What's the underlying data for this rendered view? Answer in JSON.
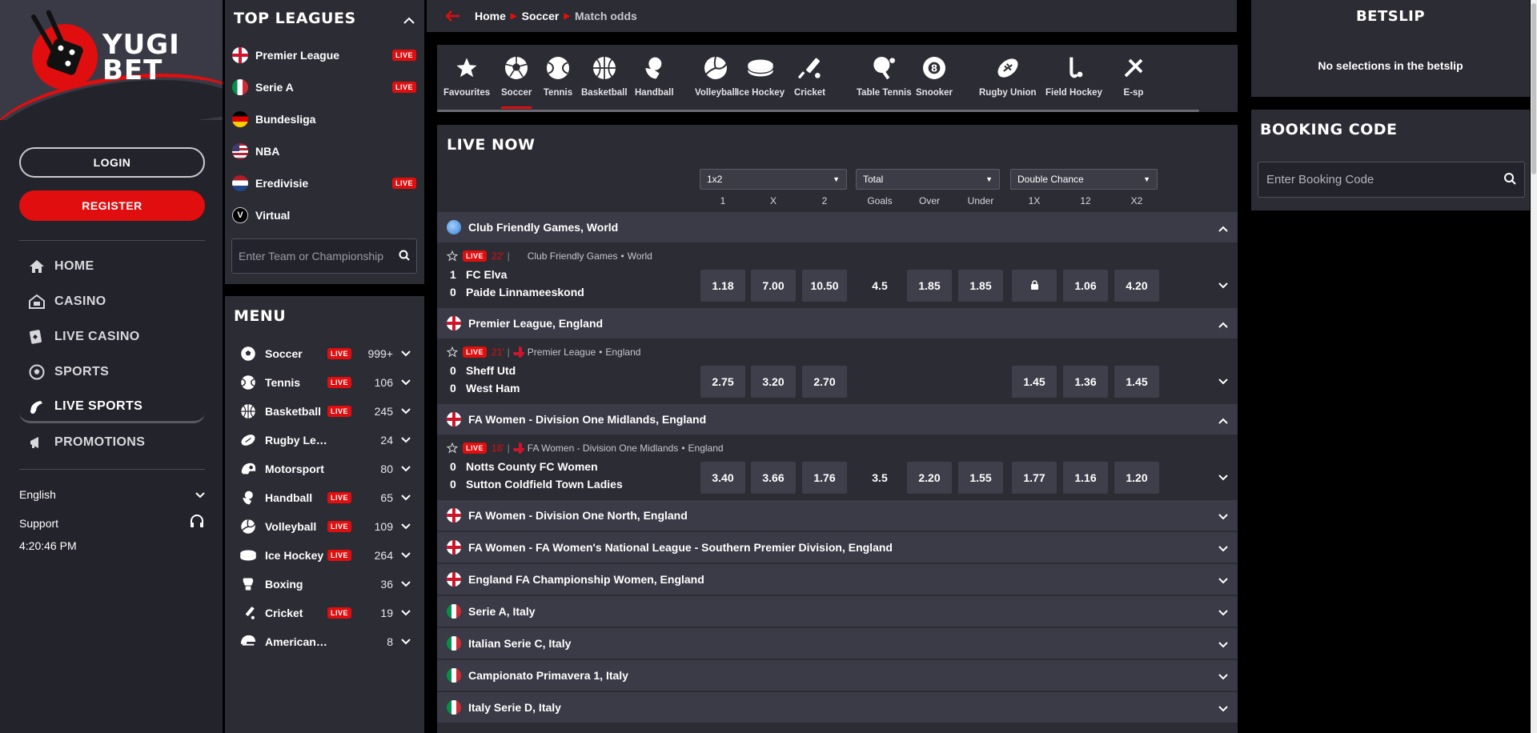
{
  "brand": {
    "line1": "YUGI",
    "line2": "BET"
  },
  "auth": {
    "login": "LOGIN",
    "register": "REGISTER"
  },
  "nav": [
    {
      "label": "HOME",
      "icon": "home-icon"
    },
    {
      "label": "CASINO",
      "icon": "casino-icon"
    },
    {
      "label": "LIVE CASINO",
      "icon": "live-casino-icon"
    },
    {
      "label": "SPORTS",
      "icon": "soccer-ball-icon"
    },
    {
      "label": "LIVE SPORTS",
      "icon": "live-sports-icon"
    },
    {
      "label": "PROMOTIONS",
      "icon": "megaphone-icon"
    }
  ],
  "footer": {
    "language": "English",
    "support": "Support",
    "time": "4:20:46 PM"
  },
  "top_leagues": {
    "title": "TOP LEAGUES",
    "items": [
      {
        "name": "Premier League",
        "flag": "england",
        "live": "LIVE"
      },
      {
        "name": "Serie A",
        "flag": "italy",
        "live": "LIVE"
      },
      {
        "name": "Bundesliga",
        "flag": "germany",
        "live": ""
      },
      {
        "name": "NBA",
        "flag": "usa",
        "live": ""
      },
      {
        "name": "Eredivisie",
        "flag": "netherlands",
        "live": "LIVE"
      },
      {
        "name": "Virtual",
        "flag": "virtual",
        "live": ""
      }
    ],
    "search_placeholder": "Enter Team or Championship"
  },
  "menu": {
    "title": "MENU",
    "items": [
      {
        "name": "Soccer",
        "live": "LIVE",
        "count": "999+"
      },
      {
        "name": "Tennis",
        "live": "LIVE",
        "count": "106"
      },
      {
        "name": "Basketball",
        "live": "LIVE",
        "count": "245"
      },
      {
        "name": "Rugby League",
        "live": "",
        "count": "24"
      },
      {
        "name": "Motorsport",
        "live": "",
        "count": "80"
      },
      {
        "name": "Handball",
        "live": "LIVE",
        "count": "65"
      },
      {
        "name": "Volleyball",
        "live": "LIVE",
        "count": "109"
      },
      {
        "name": "Ice Hockey",
        "live": "LIVE",
        "count": "264"
      },
      {
        "name": "Boxing",
        "live": "",
        "count": "36"
      },
      {
        "name": "Cricket",
        "live": "LIVE",
        "count": "19"
      },
      {
        "name": "American Football",
        "live": "",
        "count": "8"
      }
    ]
  },
  "breadcrumb": [
    "Home",
    "Soccer",
    "Match odds"
  ],
  "sports_tabs": [
    "Favourites",
    "Soccer",
    "Tennis",
    "Basketball",
    "Handball",
    "Volleyball",
    "Ice Hockey",
    "Cricket",
    "Table Tennis",
    "Snooker",
    "Rugby Union",
    "Field Hockey",
    "E-sp"
  ],
  "live": {
    "title": "LIVE NOW",
    "markets": [
      "1x2",
      "Total",
      "Double Chance"
    ],
    "columns": [
      "1",
      "X",
      "2",
      "Goals",
      "Over",
      "Under",
      "1X",
      "12",
      "X2"
    ],
    "leagues": [
      {
        "name": "Club Friendly Games, World",
        "flag": "world"
      },
      {
        "name": "Premier League, England",
        "flag": "england"
      },
      {
        "name": "FA Women - Division One Midlands, England",
        "flag": "england"
      },
      {
        "name": "FA Women - Division One North, England",
        "flag": "england"
      },
      {
        "name": "FA Women - FA Women's National League - Southern Premier Division, England",
        "flag": "england"
      },
      {
        "name": "England FA Championship Women, England",
        "flag": "england"
      },
      {
        "name": "Serie A, Italy",
        "flag": "italy"
      },
      {
        "name": "Italian Serie C, Italy",
        "flag": "italy"
      },
      {
        "name": "Campionato Primavera 1, Italy",
        "flag": "italy"
      },
      {
        "name": "Italy Serie D, Italy",
        "flag": "italy"
      }
    ],
    "matches": [
      {
        "badge": "LIVE",
        "minute": "22'",
        "competition": "Club Friendly Games",
        "region": "World",
        "home": "FC Elva",
        "away": "Paide Linnameeskond",
        "home_score": "1",
        "away_score": "0",
        "odds": [
          "1.18",
          "7.00",
          "10.50"
        ],
        "goals": "4.5",
        "over": "1.85",
        "under": "1.85",
        "dc": [
          "locked",
          "1.06",
          "4.20"
        ]
      },
      {
        "badge": "LIVE",
        "minute": "21'",
        "competition": "Premier League",
        "region": "England",
        "home": "Sheff Utd",
        "away": "West Ham",
        "home_score": "0",
        "away_score": "0",
        "odds": [
          "2.75",
          "3.20",
          "2.70"
        ],
        "goals": "",
        "over": "",
        "under": "",
        "dc": [
          "1.45",
          "1.36",
          "1.45"
        ]
      },
      {
        "badge": "LIVE",
        "minute": "18'",
        "competition": "FA Women - Division One Midlands",
        "region": "England",
        "home": "Notts County FC Women",
        "away": "Sutton Coldfield Town Ladies",
        "home_score": "0",
        "away_score": "0",
        "odds": [
          "3.40",
          "3.66",
          "1.76"
        ],
        "goals": "3.5",
        "over": "2.20",
        "under": "1.55",
        "dc": [
          "1.77",
          "1.16",
          "1.20"
        ]
      }
    ]
  },
  "betslip": {
    "title": "BETSLIP",
    "message": "No selections in the betslip"
  },
  "booking": {
    "title": "BOOKING CODE",
    "placeholder": "Enter Booking Code"
  },
  "colors": {
    "accent": "#e00e0e",
    "panel": "#2c2c35",
    "sidebar": "#23232b",
    "row": "#3b3b47"
  }
}
